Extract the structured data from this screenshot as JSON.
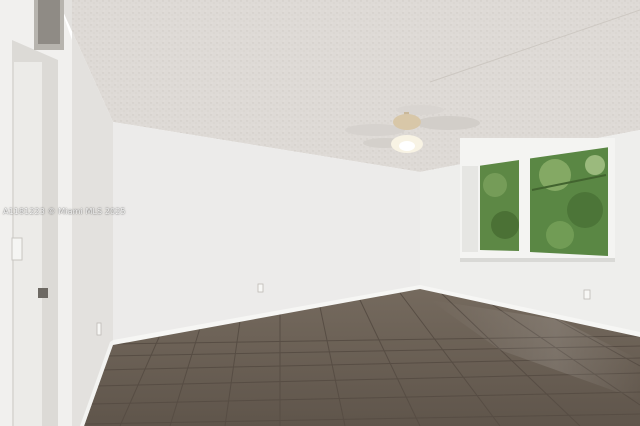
{
  "photo": {
    "watermark": "A1181223 © Miami MLS 2025"
  },
  "colors": {
    "ceiling": "#dedad6",
    "back_wall": "#ecebea",
    "left_wall": "#e6e4e2",
    "right_wall": "#eeeeec",
    "floor": "#6c6054",
    "floor_grout": "#5a5046",
    "baseboard": "#f6f6f4",
    "window_glass": "#5f8a48",
    "window_frame": "#f4f4f2"
  },
  "icons": [
    "ceiling-fan-icon",
    "window-icon",
    "door-icon",
    "outlet-icon",
    "vent-icon"
  ]
}
